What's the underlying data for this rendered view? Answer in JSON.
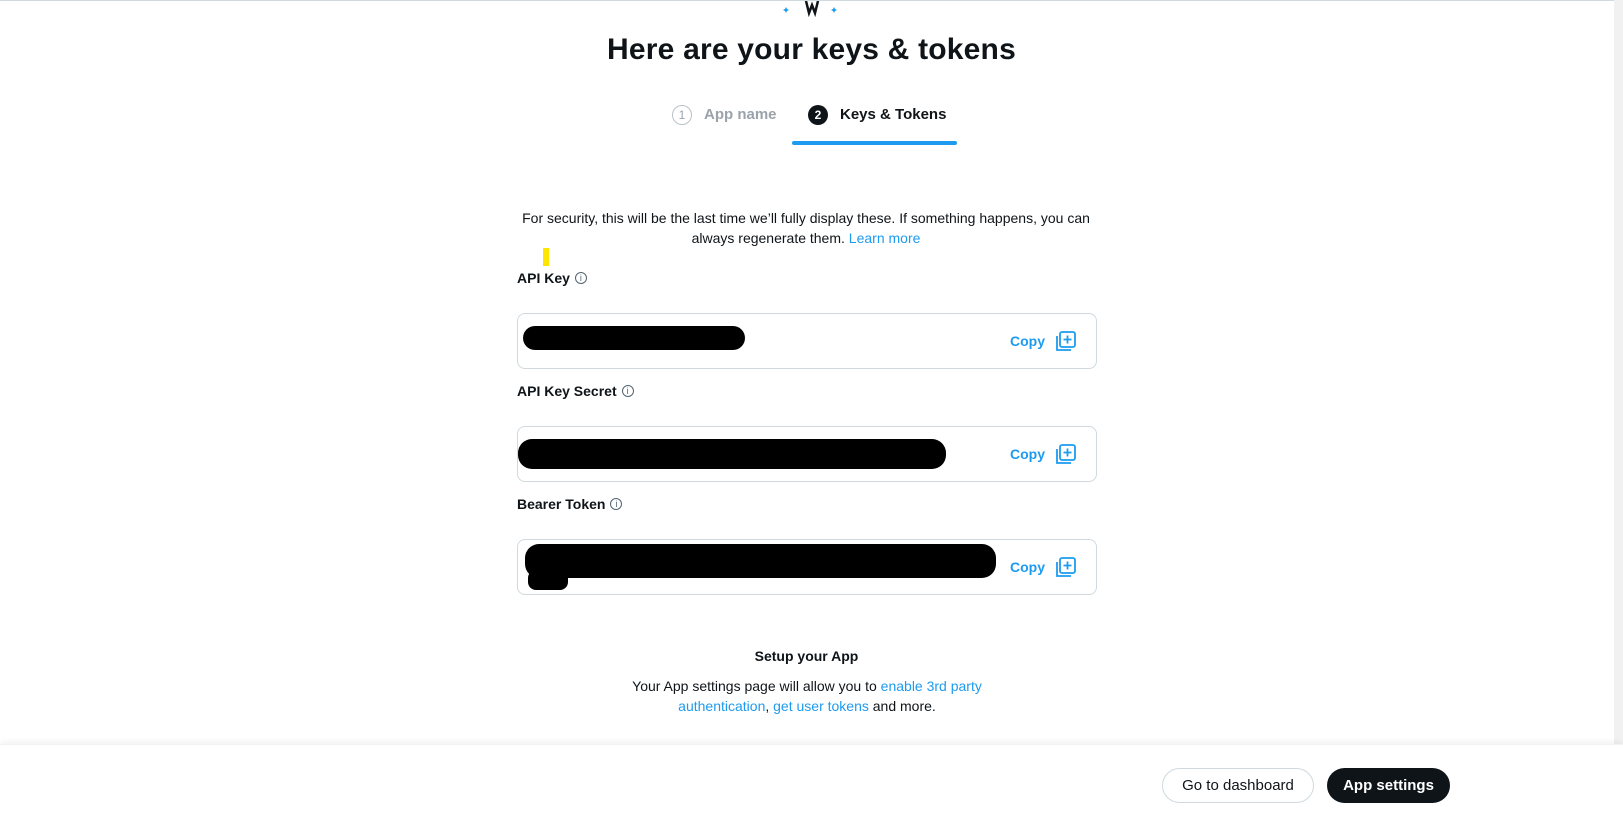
{
  "header": {
    "title": "Here are your keys & tokens",
    "steps": [
      {
        "number": "1",
        "label": "App name",
        "active": false
      },
      {
        "number": "2",
        "label": "Keys & Tokens",
        "active": true
      }
    ]
  },
  "main": {
    "note_text": "For security, this will be the last time we’ll fully display these. If something happens, you can always regenerate them.",
    "note_link": "Learn more",
    "fields": [
      {
        "label": "API Key",
        "info_icon": "info-icon",
        "copy_label": "Copy"
      },
      {
        "label": "API Key Secret",
        "info_icon": "info-icon",
        "copy_label": "Copy"
      },
      {
        "label": "Bearer Token",
        "info_icon": "info-icon",
        "copy_label": "Copy"
      }
    ],
    "setup": {
      "title": "Setup your App",
      "text_before": "Your App settings page will allow you to ",
      "link1": "enable 3rd party authentication",
      "comma": ", ",
      "link2": "get user tokens",
      "text_after": " and more."
    }
  },
  "footer": {
    "dashboard_button": "Go to dashboard",
    "settings_button": "App settings"
  },
  "colors": {
    "accent": "#1d9bf0",
    "dark": "#0f1419",
    "border": "#cfd9de"
  }
}
